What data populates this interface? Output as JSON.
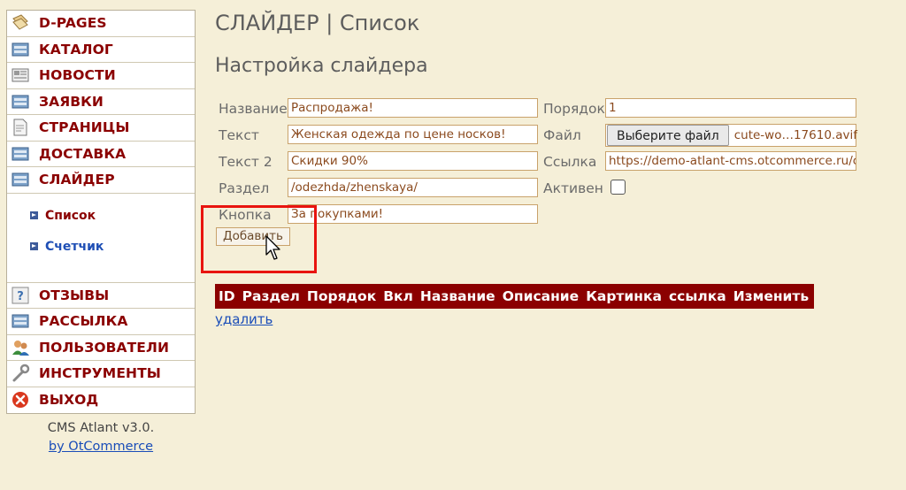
{
  "sidebar": {
    "items": [
      {
        "label": "D-PAGES",
        "icon": "pages-icon"
      },
      {
        "label": "КАТАЛОГ",
        "icon": "catalog-icon"
      },
      {
        "label": "НОВОСТИ",
        "icon": "news-icon"
      },
      {
        "label": "ЗАЯВКИ",
        "icon": "orders-icon"
      },
      {
        "label": "СТРАНИЦЫ",
        "icon": "document-icon"
      },
      {
        "label": "ДОСТАВКА",
        "icon": "delivery-icon"
      },
      {
        "label": "СЛАЙДЕР",
        "icon": "slider-icon"
      }
    ],
    "submenu": [
      {
        "label": "Список"
      },
      {
        "label": "Счетчик"
      }
    ],
    "items_after": [
      {
        "label": "ОТЗЫВЫ",
        "icon": "help-icon"
      },
      {
        "label": "РАССЫЛКА",
        "icon": "mailing-icon"
      },
      {
        "label": "ПОЛЬЗОВАТЕЛИ",
        "icon": "users-icon"
      },
      {
        "label": "ИНСТРУМЕНТЫ",
        "icon": "tools-icon"
      },
      {
        "label": "ВЫХОД",
        "icon": "exit-icon"
      }
    ],
    "footer": {
      "version": "CMS Atlant v3.0.",
      "link": "by OtCommerce"
    }
  },
  "header": {
    "title": "СЛАЙДЕР | Список",
    "subtitle": "Настройка слайдера"
  },
  "form": {
    "name_label": "Название",
    "name_value": "Распродажа!",
    "text_label": "Текст",
    "text_value": "Женская одежда по цене носков!",
    "text2_label": "Текст 2",
    "text2_value": "Скидки 90%",
    "section_label": "Раздел",
    "section_value": "/odezhda/zhenskaya/",
    "button_label": "Кнопка",
    "button_value": "За покупками!",
    "order_label": "Порядок",
    "order_value": "1",
    "file_label": "Файл",
    "file_button": "Выберите файл",
    "file_name": "cute-wo…17610.avif",
    "link_label": "Ссылка",
    "link_value": "https://demo-atlant-cms.otcommerce.ru/ca",
    "active_label": "Активен",
    "submit": "Добавить"
  },
  "table": {
    "columns": [
      "ID",
      "Раздел",
      "Порядок",
      "Вкл",
      "Название",
      "Описание",
      "Картинка",
      "ссылка",
      "Изменить"
    ],
    "delete_link": "удалить"
  },
  "colors": {
    "accent": "#8b0000",
    "link": "#1a4db8",
    "background": "#f5efd8",
    "highlight": "#e8140f"
  }
}
